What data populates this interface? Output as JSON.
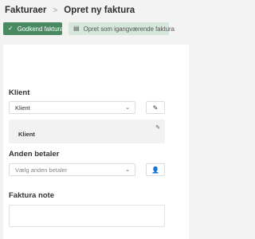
{
  "breadcrumb": {
    "parent": "Fakturaer",
    "separator": ">",
    "current": "Opret ny faktura"
  },
  "toolbar": {
    "approve": {
      "label": "Godkend faktura",
      "icon": "check-icon"
    },
    "existing": {
      "label": "Opret som igangværende faktura",
      "icon": "document-icon"
    }
  },
  "colors": {
    "primary": "#4a8a63",
    "primary_light": "#d6e7dc",
    "background": "#f3f3f4"
  },
  "form": {
    "client": {
      "label": "Klient",
      "value": "Klient",
      "selected_name": "Klient"
    },
    "other_payer": {
      "label": "Anden betaler",
      "placeholder": "Vælg anden betaler"
    },
    "note": {
      "label": "Faktura note",
      "value": ""
    }
  }
}
